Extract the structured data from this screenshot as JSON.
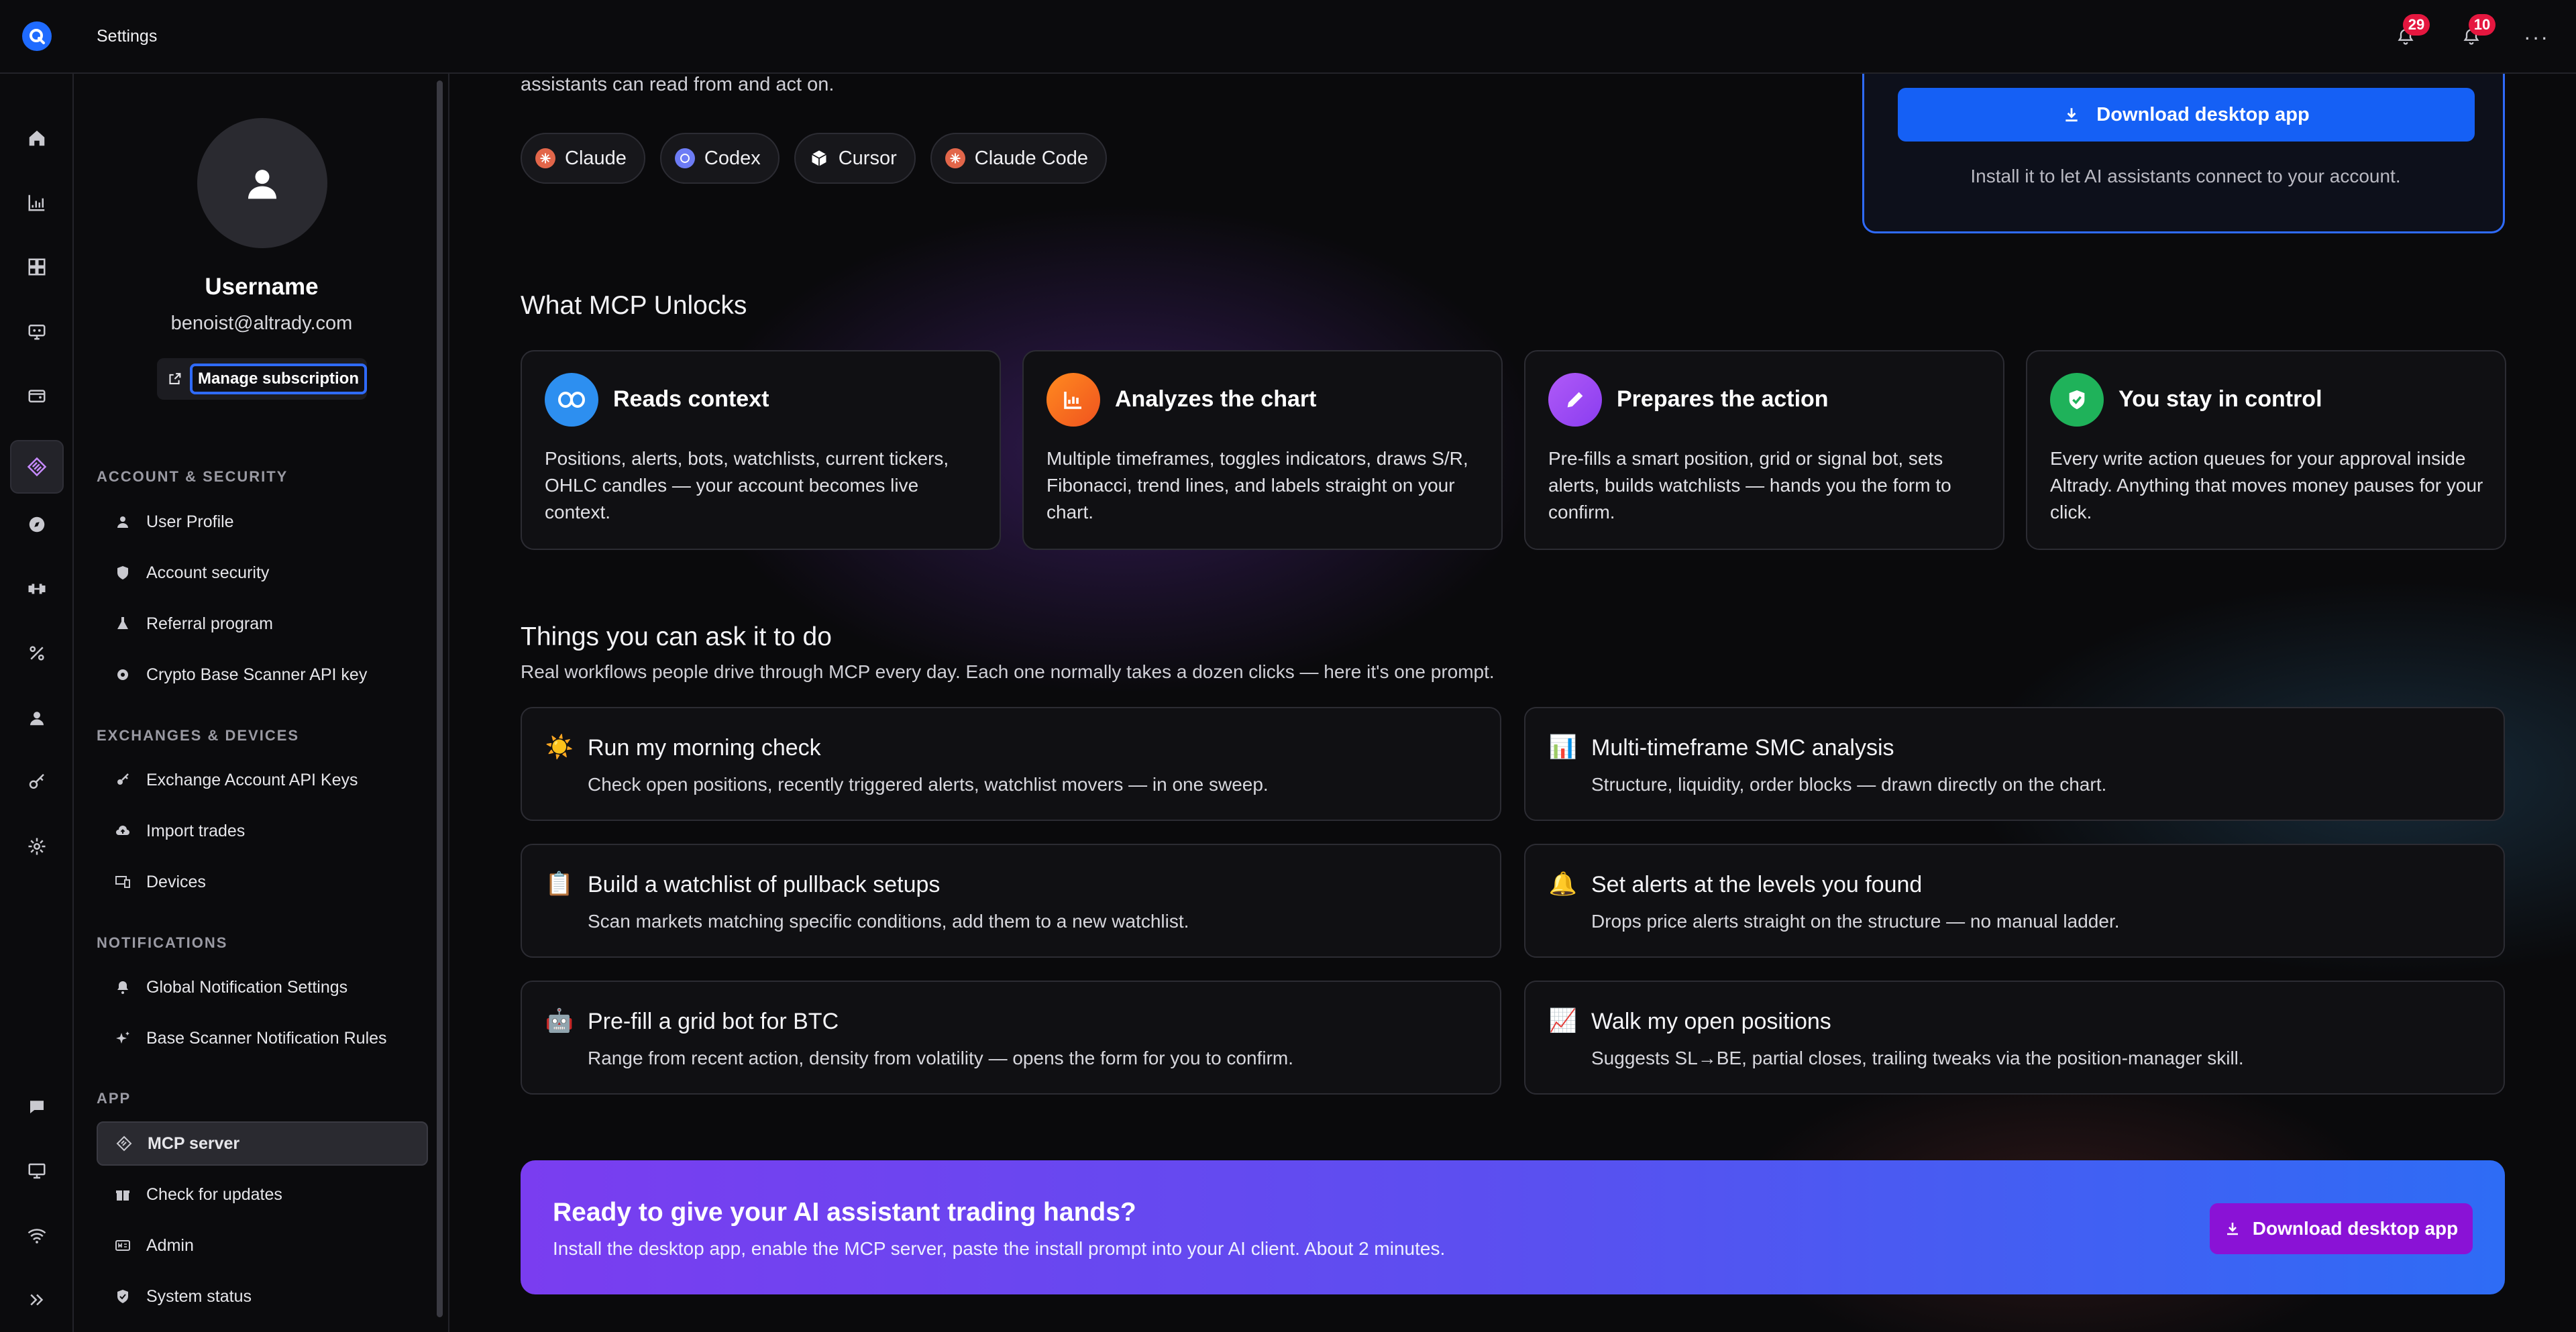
{
  "header": {
    "title": "Settings",
    "alerts_badge": "29",
    "notifications_badge": "10",
    "more": "···"
  },
  "sidebar": {
    "username": "Username",
    "email": "benoist@altrady.com",
    "manage_label": "Manage subscription",
    "sections": {
      "account": "ACCOUNT & SECURITY",
      "exchanges": "EXCHANGES & DEVICES",
      "notifications": "NOTIFICATIONS",
      "app": "APP"
    },
    "items": {
      "user_profile": "User Profile",
      "account_security": "Account security",
      "referral": "Referral program",
      "scanner_key": "Crypto Base Scanner API key",
      "exchange_keys": "Exchange Account API Keys",
      "import_trades": "Import trades",
      "devices": "Devices",
      "global_notif": "Global Notification Settings",
      "scanner_rules": "Base Scanner Notification Rules",
      "mcp_server": "MCP server",
      "updates": "Check for updates",
      "admin": "Admin",
      "system_status": "System status"
    }
  },
  "main": {
    "intro": "assistants can read from and act on.",
    "clients": [
      "Claude",
      "Codex",
      "Cursor",
      "Claude Code"
    ],
    "download": {
      "label": "Download desktop app",
      "note": "Install it to let AI assistants connect to your account."
    },
    "unlocks_title": "What MCP Unlocks",
    "unlocks": [
      {
        "title": "Reads context",
        "desc": "Positions, alerts, bots, watchlists, current tickers, OHLC candles — your account becomes live context."
      },
      {
        "title": "Analyzes the chart",
        "desc": "Multiple timeframes, toggles indicators, draws S/R, Fibonacci, trend lines, and labels straight on your chart."
      },
      {
        "title": "Prepares the action",
        "desc": "Pre-fills a smart position, grid or signal bot, sets alerts, builds watchlists — hands you the form to confirm."
      },
      {
        "title": "You stay in control",
        "desc": "Every write action queues for your approval inside Altrady. Anything that moves money pauses for your click."
      }
    ],
    "tasks_title": "Things you can ask it to do",
    "tasks_sub": "Real workflows people drive through MCP every day. Each one normally takes a dozen clicks — here it's one prompt.",
    "tasks": [
      {
        "emoji": "☀️",
        "title": "Run my morning check",
        "desc": "Check open positions, recently triggered alerts, watchlist movers — in one sweep."
      },
      {
        "emoji": "📊",
        "title": "Multi-timeframe SMC analysis",
        "desc": "Structure, liquidity, order blocks — drawn directly on the chart."
      },
      {
        "emoji": "📋",
        "title": "Build a watchlist of pullback setups",
        "desc": "Scan markets matching specific conditions, add them to a new watchlist."
      },
      {
        "emoji": "🔔",
        "title": "Set alerts at the levels you found",
        "desc": "Drops price alerts straight on the structure — no manual ladder."
      },
      {
        "emoji": "🤖",
        "title": "Pre-fill a grid bot for BTC",
        "desc": "Range from recent action, density from volatility — opens the form for you to confirm."
      },
      {
        "emoji": "📈",
        "title": "Walk my open positions",
        "desc": "Suggests SL→BE, partial closes, trailing tweaks via the position-manager skill."
      }
    ],
    "cta": {
      "title": "Ready to give your AI assistant trading hands?",
      "sub": "Install the desktop app, enable the MCP server, paste the install prompt into your AI client. About 2 minutes.",
      "button": "Download desktop app"
    }
  },
  "colors": {
    "accent": "#1560f5",
    "mcp": "#c78bff",
    "badge": "#e5173f",
    "cta_button": "#8a12d6"
  }
}
